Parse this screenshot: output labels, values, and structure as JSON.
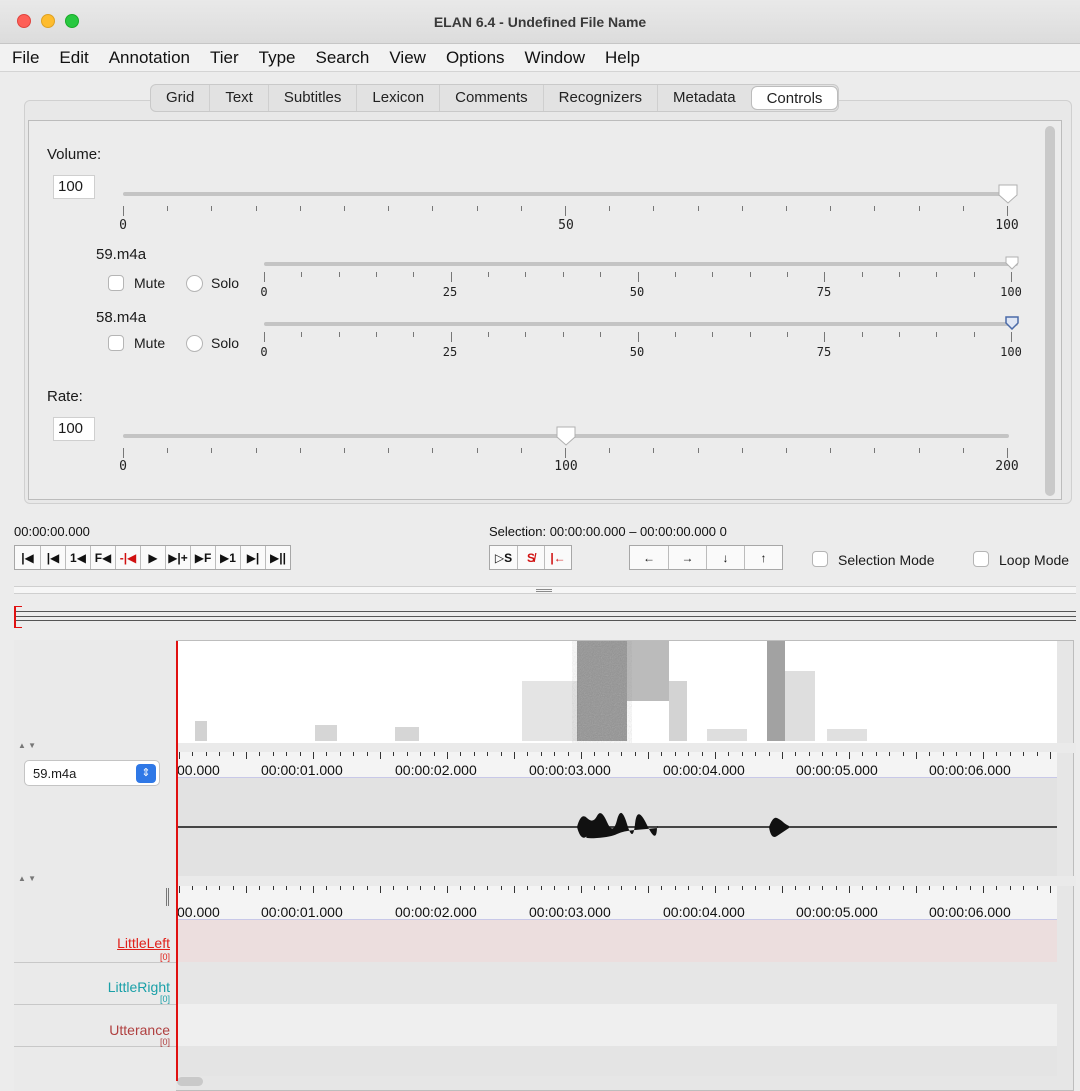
{
  "window": {
    "title": "ELAN 6.4 - Undefined File Name"
  },
  "menu": [
    "File",
    "Edit",
    "Annotation",
    "Tier",
    "Type",
    "Search",
    "View",
    "Options",
    "Window",
    "Help"
  ],
  "tabs": [
    "Grid",
    "Text",
    "Subtitles",
    "Lexicon",
    "Comments",
    "Recognizers",
    "Metadata",
    "Controls"
  ],
  "active_tab": "Controls",
  "controls": {
    "volume": {
      "label": "Volume:",
      "value": "100",
      "level": 100,
      "tick_labels": [
        "0",
        "50",
        "100"
      ]
    },
    "tracks": [
      {
        "name": "59.m4a",
        "mute": "Mute",
        "solo": "Solo",
        "level": 100,
        "tick_labels": [
          "0",
          "25",
          "50",
          "75",
          "100"
        ]
      },
      {
        "name": "58.m4a",
        "mute": "Mute",
        "solo": "Solo",
        "level": 100,
        "tick_labels": [
          "0",
          "25",
          "50",
          "75",
          "100"
        ]
      }
    ],
    "rate": {
      "label": "Rate:",
      "value": "100",
      "level": 100,
      "tick_labels": [
        "0",
        "100",
        "200"
      ]
    }
  },
  "player": {
    "current_time": "00:00:00.000",
    "selection": "Selection: 00:00:00.000 – 00:00:00.000  0",
    "transport_buttons": [
      "go-to-begin",
      "previous-frame-set",
      "previous-second",
      "previous-frame",
      "previous-pixel",
      "play",
      "next-pixel",
      "next-frame",
      "next-second",
      "next-frame-set",
      "go-to-end"
    ],
    "transport_glyphs": [
      "|◀",
      "|◀",
      "1◀",
      "F◀",
      "-|◀",
      "▶",
      "▶|+",
      "▶F",
      "▶1",
      "▶|",
      "▶||"
    ],
    "selection_buttons_glyphs": [
      "▷S",
      "S̸",
      "|←"
    ],
    "arrow_buttons_glyphs": [
      "←",
      "→",
      "↓",
      "↑"
    ],
    "selection_mode_label": "Selection Mode",
    "loop_mode_label": "Loop Mode"
  },
  "timeline": {
    "media_select": "59.m4a",
    "ruler_labels": [
      "00.000",
      "00:00:01.000",
      "00:00:02.000",
      "00:00:03.000",
      "00:00:04.000",
      "00:00:05.000",
      "00:00:06.000"
    ],
    "tiers": [
      {
        "name": "LittleLeft",
        "count": "[0]",
        "color": "#e0201a"
      },
      {
        "name": "LittleRight",
        "count": "[0]",
        "color": "#1aa0a8"
      },
      {
        "name": "Utterance",
        "count": "[0]",
        "color": "#b04040"
      }
    ]
  }
}
